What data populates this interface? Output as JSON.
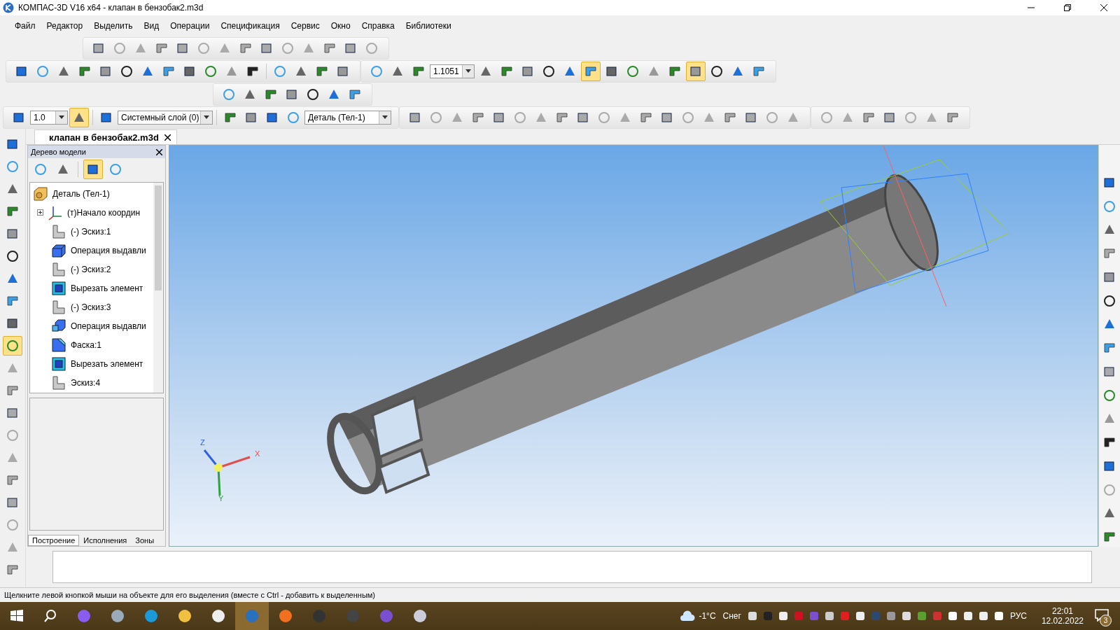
{
  "window": {
    "title": "КОМПАС-3D V16  x64 - клапан в бензобак2.m3d"
  },
  "menu": [
    "Файл",
    "Редактор",
    "Выделить",
    "Вид",
    "Операции",
    "Спецификация",
    "Сервис",
    "Окно",
    "Справка",
    "Библиотеки"
  ],
  "toolbar": {
    "zoom_value": "1.1051",
    "line_step": "1.0",
    "layer": "Системный слой (0)",
    "body": "Деталь (Тел-1)"
  },
  "document_tabs": [
    {
      "label": "клапан в бензобак2.m3d",
      "selected": true
    }
  ],
  "model_tree": {
    "title": "Дерево модели",
    "root": {
      "label": "Деталь (Тел-1)",
      "kind": "part",
      "children": [
        {
          "label": "(т)Начало координ",
          "kind": "origin",
          "expanded": false
        },
        {
          "label": "(-) Эскиз:1",
          "kind": "sketch"
        },
        {
          "label": "Операция выдавли",
          "kind": "extrude"
        },
        {
          "label": "(-) Эскиз:2",
          "kind": "sketch"
        },
        {
          "label": "Вырезать элемент",
          "kind": "cut"
        },
        {
          "label": "(-) Эскиз:3",
          "kind": "sketch"
        },
        {
          "label": "Операция выдавли",
          "kind": "boss"
        },
        {
          "label": "Фаска:1",
          "kind": "chamfer"
        },
        {
          "label": "Вырезать элемент",
          "kind": "cut"
        },
        {
          "label": "Эскиз:4",
          "kind": "sketch"
        }
      ]
    },
    "tabs": [
      {
        "label": "Построение",
        "selected": true
      },
      {
        "label": "Исполнения",
        "selected": false
      },
      {
        "label": "Зоны",
        "selected": false
      }
    ]
  },
  "viewport": {
    "axes": [
      "Z",
      "X",
      "Y"
    ]
  },
  "status_bar": "Щелкните левой кнопкой мыши на объекте для его выделения (вместе с Ctrl - добавить к выделенным)",
  "taskbar": {
    "weather": "-1°C",
    "weather_text": "Снег",
    "language": "РУС",
    "time": "22:01",
    "date": "12.02.2022",
    "notifications": "3"
  }
}
